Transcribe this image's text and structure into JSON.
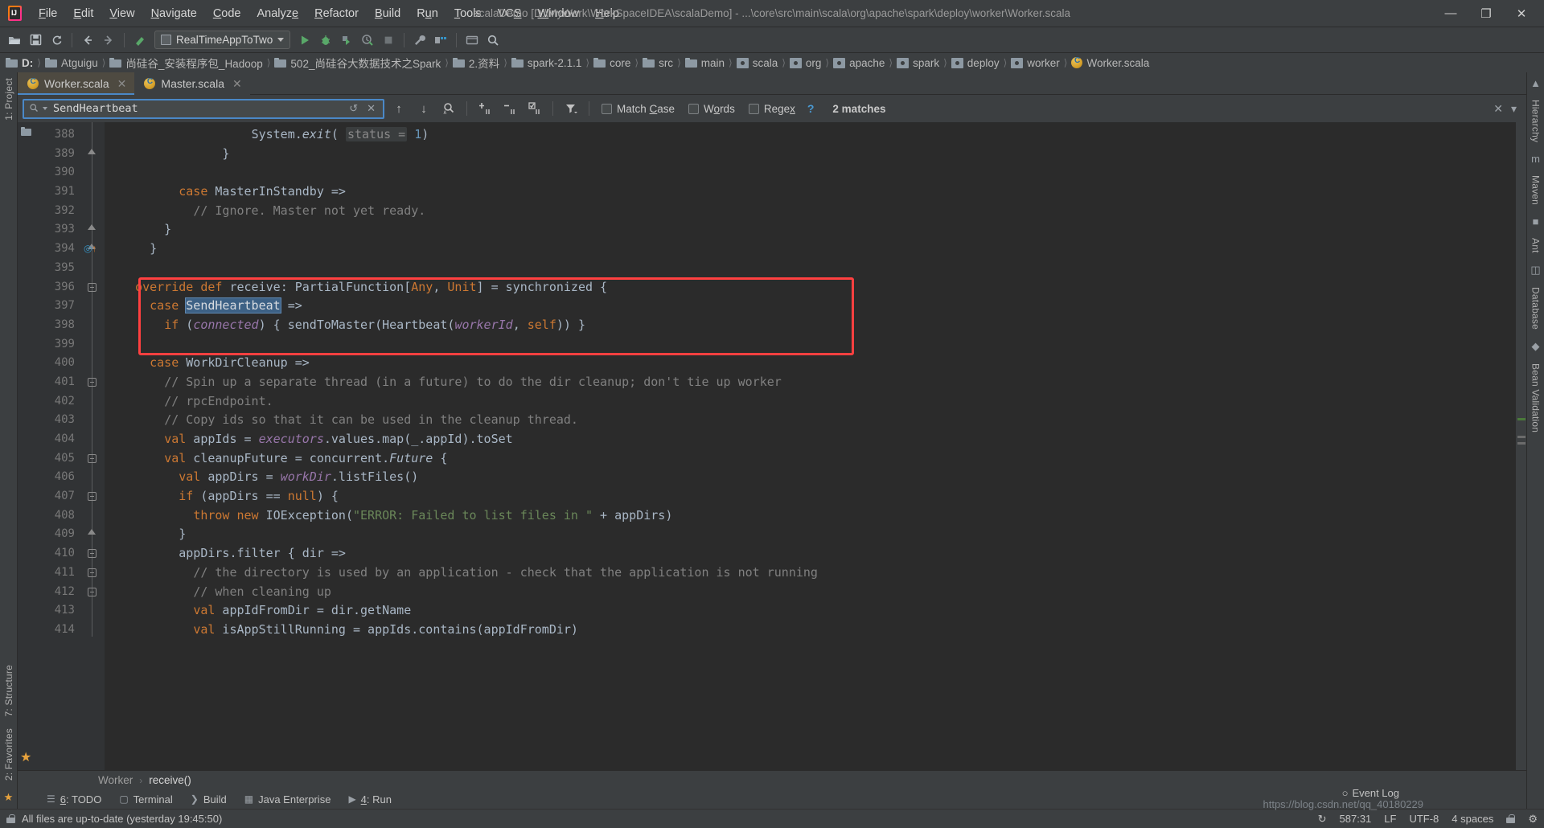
{
  "window": {
    "title": "scalaDemo [D:\\MyWork\\WorkSpaceIDEA\\scalaDemo] - ...\\core\\src\\main\\scala\\org\\apache\\spark\\deploy\\worker\\Worker.scala",
    "minimize": "—",
    "maximize": "❐",
    "close": "✕"
  },
  "menu": [
    {
      "label": "File"
    },
    {
      "label": "Edit"
    },
    {
      "label": "View"
    },
    {
      "label": "Navigate"
    },
    {
      "label": "Code"
    },
    {
      "label": "Analyze"
    },
    {
      "label": "Refactor"
    },
    {
      "label": "Build"
    },
    {
      "label": "Run"
    },
    {
      "label": "Tools"
    },
    {
      "label": "VCS"
    },
    {
      "label": "Window"
    },
    {
      "label": "Help"
    }
  ],
  "toolbar": {
    "open_icon": "open-folder-icon",
    "save_icon": "save-icon",
    "sync_icon": "sync-icon",
    "back_icon": "←",
    "forward_icon": "→",
    "build_icon": "hammer-icon",
    "run_config": "RealTimeAppToTwo",
    "run_icon": "▶",
    "debug_icon": "debug-icon",
    "coverage_icon": "coverage-icon",
    "profile_icon": "profile-icon",
    "stop_icon": "■",
    "settings_icon": "wrench-icon",
    "project_structure_icon": "project-structure-icon",
    "updates_icon": "updates-icon",
    "search_icon": "⚲"
  },
  "breadcrumb": [
    {
      "label": "D:",
      "icon": "folder-icon",
      "bold": true
    },
    {
      "label": "Atguigu",
      "icon": "folder-icon",
      "bold": false
    },
    {
      "label": "尚硅谷_安装程序包_Hadoop",
      "icon": "folder-icon",
      "bold": false
    },
    {
      "label": "502_尚硅谷大数据技术之Spark",
      "icon": "folder-icon",
      "bold": false
    },
    {
      "label": "2.资料",
      "icon": "folder-icon",
      "bold": false
    },
    {
      "label": "spark-2.1.1",
      "icon": "folder-icon",
      "bold": false
    },
    {
      "label": "core",
      "icon": "folder-icon",
      "bold": false
    },
    {
      "label": "src",
      "icon": "folder-icon",
      "bold": false
    },
    {
      "label": "main",
      "icon": "folder-icon",
      "bold": false
    },
    {
      "label": "scala",
      "icon": "package-icon",
      "bold": false
    },
    {
      "label": "org",
      "icon": "package-icon",
      "bold": false
    },
    {
      "label": "apache",
      "icon": "package-icon",
      "bold": false
    },
    {
      "label": "spark",
      "icon": "package-icon",
      "bold": false
    },
    {
      "label": "deploy",
      "icon": "package-icon",
      "bold": false
    },
    {
      "label": "worker",
      "icon": "package-icon",
      "bold": false
    },
    {
      "label": "Worker.scala",
      "icon": "scala-file-icon",
      "bold": false
    }
  ],
  "left_rail": [
    {
      "label": "1: Project"
    },
    {
      "label": "7: Structure"
    },
    {
      "label": "2: Favorites"
    }
  ],
  "right_rail": [
    {
      "label": "Hierarchy"
    },
    {
      "label": "Maven"
    },
    {
      "label": "Ant"
    },
    {
      "label": "Database"
    },
    {
      "label": "Bean Validation"
    }
  ],
  "tabs": [
    {
      "label": "Worker.scala",
      "icon": "scala-file-icon",
      "active": true,
      "close": "✕"
    },
    {
      "label": "Master.scala",
      "icon": "scala-file-icon",
      "active": false,
      "close": "✕"
    }
  ],
  "find": {
    "value": "SendHeartbeat",
    "placeholder": "Search",
    "search_icon": "⚲",
    "history_icon": "↺",
    "clear_icon": "✕",
    "prev_icon": "↑",
    "next_icon": "↓",
    "select_all_icon": "select-all-occurrences-icon",
    "add_line_icon": "add-selection-icon",
    "remove_line_icon": "remove-selection-icon",
    "select_all_lines_icon": "select-all-lines-icon",
    "filter_icon": "filter-icon",
    "match_case_label": "Match Case",
    "words_label": "Words",
    "regex_label": "Regex",
    "help_label": "?",
    "matches_label": "2 matches",
    "close_icon": "✕",
    "menu_icon": "▾"
  },
  "code": {
    "first_line": 388,
    "lines": [
      {
        "n": 388,
        "fold": "none",
        "html": "                  <span class='cls'>System</span>.<span class='ital'>exit</span>( <span class='hint'>status =</span> <span class='num'>1</span>)"
      },
      {
        "n": 389,
        "fold": "end",
        "html": "              }"
      },
      {
        "n": 390,
        "fold": "none",
        "html": ""
      },
      {
        "n": 391,
        "fold": "none",
        "html": "        <span class='kw'>case</span> MasterInStandby =>"
      },
      {
        "n": 392,
        "fold": "none",
        "html": "          <span class='cmt'>// Ignore. Master not yet ready.</span>"
      },
      {
        "n": 393,
        "fold": "end",
        "html": "      }"
      },
      {
        "n": 394,
        "fold": "end",
        "html": "    }"
      },
      {
        "n": 395,
        "fold": "none",
        "html": ""
      },
      {
        "n": 396,
        "fold": "start",
        "html": "  <span class='kw'>override def</span> <span class='typ'>receive</span>: PartialFunction[<span class='kw'>Any</span>, <span class='kw'>Unit</span>] = synchronized {"
      },
      {
        "n": 397,
        "fold": "none",
        "html": "    <span class='kw'>case</span> <span class='hl'>SendHeartbeat</span> =>"
      },
      {
        "n": 398,
        "fold": "none",
        "html": "      <span class='kw'>if</span> (<span class='fld'>connected</span>) { sendToMaster(Heartbeat(<span class='fld'>workerId</span>, <span class='kw'>self</span>)) }"
      },
      {
        "n": 399,
        "fold": "none",
        "html": ""
      },
      {
        "n": 400,
        "fold": "none",
        "html": "    <span class='kw'>case</span> WorkDirCleanup =>"
      },
      {
        "n": 401,
        "fold": "start",
        "html": "      <span class='cmt'>// Spin up a separate thread (in a future) to do the dir cleanup; don't tie up worker</span>"
      },
      {
        "n": 402,
        "fold": "none",
        "html": "      <span class='cmt'>// rpcEndpoint.</span>"
      },
      {
        "n": 403,
        "fold": "none",
        "html": "      <span class='cmt'>// Copy ids so that it can be used in the cleanup thread.</span>"
      },
      {
        "n": 404,
        "fold": "none",
        "html": "      <span class='kw'>val</span> appIds = <span class='fld'>executors</span>.values.map(_.appId).toSet"
      },
      {
        "n": 405,
        "fold": "start",
        "html": "      <span class='kw'>val</span> cleanupFuture = concurrent.<span class='ital'>Future</span> {"
      },
      {
        "n": 406,
        "fold": "none",
        "html": "        <span class='kw'>val</span> appDirs = <span class='fld'>workDir</span>.listFiles()"
      },
      {
        "n": 407,
        "fold": "start",
        "html": "        <span class='kw'>if</span> (appDirs == <span class='kw'>null</span>) {"
      },
      {
        "n": 408,
        "fold": "none",
        "html": "          <span class='kw'>throw new</span> IOException(<span class='str'>\"ERROR: Failed to list files in \"</span> + appDirs)"
      },
      {
        "n": 409,
        "fold": "end",
        "html": "        }"
      },
      {
        "n": 410,
        "fold": "start",
        "html": "        appDirs.filter { dir =>"
      },
      {
        "n": 411,
        "fold": "start",
        "html": "          <span class='cmt'>// the directory is used by an application - check that the application is not running</span>"
      },
      {
        "n": 412,
        "fold": "start",
        "html": "          <span class='cmt'>// when cleaning up</span>"
      },
      {
        "n": 413,
        "fold": "none",
        "html": "          <span class='kw'>val</span> appIdFromDir = dir.getName"
      },
      {
        "n": 414,
        "fold": "none",
        "html": "          <span class='kw'>val</span> isAppStillRunning = appIds.contains(appIdFromDir)"
      }
    ],
    "annotation": {
      "type": "red-rectangle",
      "note": "highlights lines 396-398"
    },
    "inspection_icon": "✓",
    "breakpoint_hint_icon": "override-marker-icon"
  },
  "navigation": {
    "class": "Worker",
    "separator": "›",
    "member": "receive()"
  },
  "tool_windows": [
    {
      "label": "6: TODO",
      "underline": "6",
      "icon": "todo-icon"
    },
    {
      "label": "Terminal",
      "underline": "",
      "icon": "terminal-icon"
    },
    {
      "label": "Build",
      "underline": "",
      "icon": "build-icon"
    },
    {
      "label": "Java Enterprise",
      "underline": "",
      "icon": "java-enterprise-icon"
    },
    {
      "label": "4: Run",
      "underline": "4",
      "icon": "run-icon"
    }
  ],
  "status": {
    "message": "All files are up-to-date (yesterday 19:45:50)",
    "message_icon": "file-icon",
    "caret_position": "587:31",
    "line_separator": "LF",
    "encoding": "UTF-8",
    "indent": "4 spaces",
    "event_log": "Event Log",
    "event_log_icon": "○",
    "lock_icon": "lock-icon",
    "watermark": "https://blog.csdn.net/qq_40180229"
  },
  "colors": {
    "accent": "#4a88c7",
    "annotation_red": "#ff4040",
    "keyword_orange": "#cc7832",
    "string_green": "#6a8759",
    "comment_gray": "#808080",
    "field_purple": "#9876aa",
    "number_blue": "#6897bb",
    "editor_bg": "#2b2b2b",
    "chrome_bg": "#3c3f41"
  }
}
